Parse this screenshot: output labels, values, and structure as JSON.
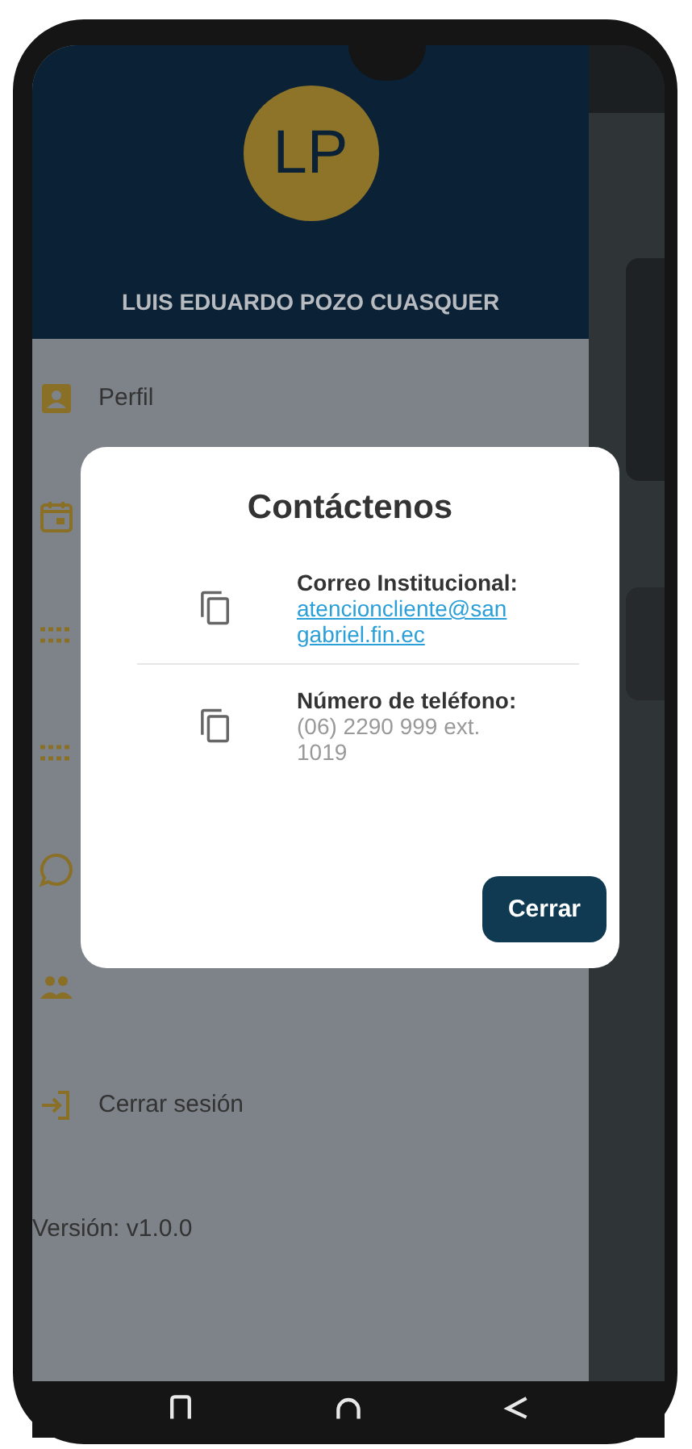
{
  "user": {
    "initials": "LP",
    "name": "LUIS EDUARDO POZO CUASQUER"
  },
  "drawer_items": [
    {
      "kind": "profile",
      "label": "Perfil"
    },
    {
      "kind": "calendar"
    },
    {
      "kind": "dots"
    },
    {
      "kind": "dots"
    },
    {
      "kind": "chat"
    },
    {
      "kind": "people"
    },
    {
      "kind": "logout",
      "label": "Cerrar sesión"
    }
  ],
  "version": "Versión: v1.0.0",
  "dialog": {
    "title": "Contáctenos",
    "items": [
      {
        "kind": "link",
        "label": "Correo Institucional:",
        "value": "atencioncliente@sangabriel.fin.ec"
      },
      {
        "kind": "text",
        "label": "Número de teléfono:",
        "value": "(06) 2290 999 ext. 1019"
      }
    ],
    "button": "Cerrar"
  }
}
